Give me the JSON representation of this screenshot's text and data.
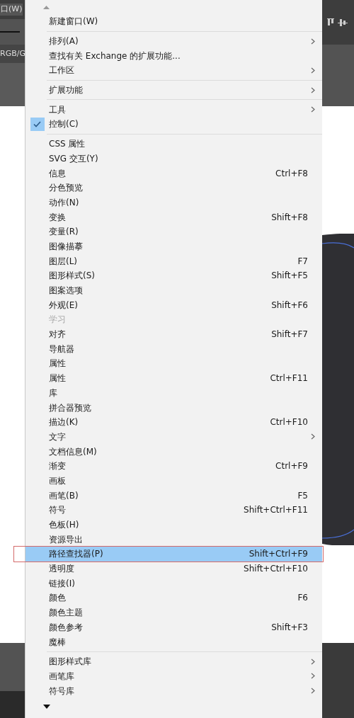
{
  "app_menubar": {
    "item": "口(W)"
  },
  "app_toolbar": {
    "color_mode": "RGB/G"
  },
  "menu": {
    "groups": [
      {
        "items": [
          {
            "label": "新建窗口(W)",
            "submenu": false,
            "checked": false,
            "disabled": false,
            "selected": false
          }
        ]
      },
      {
        "items": [
          {
            "label": "排列(A)",
            "submenu": true,
            "checked": false,
            "disabled": false,
            "selected": false
          },
          {
            "label": "查找有关 Exchange 的扩展功能...",
            "submenu": false,
            "checked": false,
            "disabled": false,
            "selected": false
          },
          {
            "label": "工作区",
            "submenu": true,
            "checked": false,
            "disabled": false,
            "selected": false
          }
        ]
      },
      {
        "items": [
          {
            "label": "扩展功能",
            "submenu": true,
            "checked": false,
            "disabled": false,
            "selected": false
          }
        ]
      },
      {
        "items": [
          {
            "label": "工具",
            "submenu": true,
            "checked": false,
            "disabled": false,
            "selected": false
          },
          {
            "label": "控制(C)",
            "submenu": false,
            "checked": true,
            "disabled": false,
            "selected": false
          }
        ]
      },
      {
        "items": [
          {
            "label": "CSS 属性",
            "submenu": false,
            "checked": false,
            "disabled": false,
            "selected": false
          },
          {
            "label": "SVG 交互(Y)",
            "submenu": false,
            "checked": false,
            "disabled": false,
            "selected": false
          },
          {
            "label": "信息",
            "shortcut": "Ctrl+F8",
            "submenu": false,
            "checked": false,
            "disabled": false,
            "selected": false
          },
          {
            "label": "分色预览",
            "submenu": false,
            "checked": false,
            "disabled": false,
            "selected": false
          },
          {
            "label": "动作(N)",
            "submenu": false,
            "checked": false,
            "disabled": false,
            "selected": false
          },
          {
            "label": "变换",
            "shortcut": "Shift+F8",
            "submenu": false,
            "checked": false,
            "disabled": false,
            "selected": false
          },
          {
            "label": "变量(R)",
            "submenu": false,
            "checked": false,
            "disabled": false,
            "selected": false
          },
          {
            "label": "图像描摹",
            "submenu": false,
            "checked": false,
            "disabled": false,
            "selected": false
          },
          {
            "label": "图层(L)",
            "shortcut": "F7",
            "submenu": false,
            "checked": false,
            "disabled": false,
            "selected": false
          },
          {
            "label": "图形样式(S)",
            "shortcut": "Shift+F5",
            "submenu": false,
            "checked": false,
            "disabled": false,
            "selected": false
          },
          {
            "label": "图案选项",
            "submenu": false,
            "checked": false,
            "disabled": false,
            "selected": false
          },
          {
            "label": "外观(E)",
            "shortcut": "Shift+F6",
            "submenu": false,
            "checked": false,
            "disabled": false,
            "selected": false
          },
          {
            "label": "学习",
            "submenu": false,
            "checked": false,
            "disabled": true,
            "selected": false
          },
          {
            "label": "对齐",
            "shortcut": "Shift+F7",
            "submenu": false,
            "checked": false,
            "disabled": false,
            "selected": false
          },
          {
            "label": "导航器",
            "submenu": false,
            "checked": false,
            "disabled": false,
            "selected": false
          },
          {
            "label": "属性",
            "submenu": false,
            "checked": false,
            "disabled": false,
            "selected": false
          },
          {
            "label": "属性",
            "shortcut": "Ctrl+F11",
            "submenu": false,
            "checked": false,
            "disabled": false,
            "selected": false
          },
          {
            "label": "库",
            "submenu": false,
            "checked": false,
            "disabled": false,
            "selected": false
          },
          {
            "label": "拼合器预览",
            "submenu": false,
            "checked": false,
            "disabled": false,
            "selected": false
          },
          {
            "label": "描边(K)",
            "shortcut": "Ctrl+F10",
            "submenu": false,
            "checked": false,
            "disabled": false,
            "selected": false
          },
          {
            "label": "文字",
            "submenu": true,
            "checked": false,
            "disabled": false,
            "selected": false
          },
          {
            "label": "文档信息(M)",
            "submenu": false,
            "checked": false,
            "disabled": false,
            "selected": false
          },
          {
            "label": "渐变",
            "shortcut": "Ctrl+F9",
            "submenu": false,
            "checked": false,
            "disabled": false,
            "selected": false
          },
          {
            "label": "画板",
            "submenu": false,
            "checked": false,
            "disabled": false,
            "selected": false
          },
          {
            "label": "画笔(B)",
            "shortcut": "F5",
            "submenu": false,
            "checked": false,
            "disabled": false,
            "selected": false
          },
          {
            "label": "符号",
            "shortcut": "Shift+Ctrl+F11",
            "submenu": false,
            "checked": false,
            "disabled": false,
            "selected": false
          },
          {
            "label": "色板(H)",
            "submenu": false,
            "checked": false,
            "disabled": false,
            "selected": false
          },
          {
            "label": "资源导出",
            "submenu": false,
            "checked": false,
            "disabled": false,
            "selected": false
          },
          {
            "label": "路径查找器(P)",
            "shortcut": "Shift+Ctrl+F9",
            "submenu": false,
            "checked": false,
            "disabled": false,
            "selected": true
          },
          {
            "label": "透明度",
            "shortcut": "Shift+Ctrl+F10",
            "submenu": false,
            "checked": false,
            "disabled": false,
            "selected": false
          },
          {
            "label": "链接(I)",
            "submenu": false,
            "checked": false,
            "disabled": false,
            "selected": false
          },
          {
            "label": "颜色",
            "shortcut": "F6",
            "submenu": false,
            "checked": false,
            "disabled": false,
            "selected": false
          },
          {
            "label": "颜色主题",
            "submenu": false,
            "checked": false,
            "disabled": false,
            "selected": false
          },
          {
            "label": "颜色参考",
            "shortcut": "Shift+F3",
            "submenu": false,
            "checked": false,
            "disabled": false,
            "selected": false
          },
          {
            "label": "魔棒",
            "submenu": false,
            "checked": false,
            "disabled": false,
            "selected": false
          }
        ]
      },
      {
        "items": [
          {
            "label": "图形样式库",
            "submenu": true,
            "checked": false,
            "disabled": false,
            "selected": false
          },
          {
            "label": "画笔库",
            "submenu": true,
            "checked": false,
            "disabled": false,
            "selected": false
          },
          {
            "label": "符号库",
            "submenu": true,
            "checked": false,
            "disabled": false,
            "selected": false
          }
        ]
      }
    ]
  }
}
